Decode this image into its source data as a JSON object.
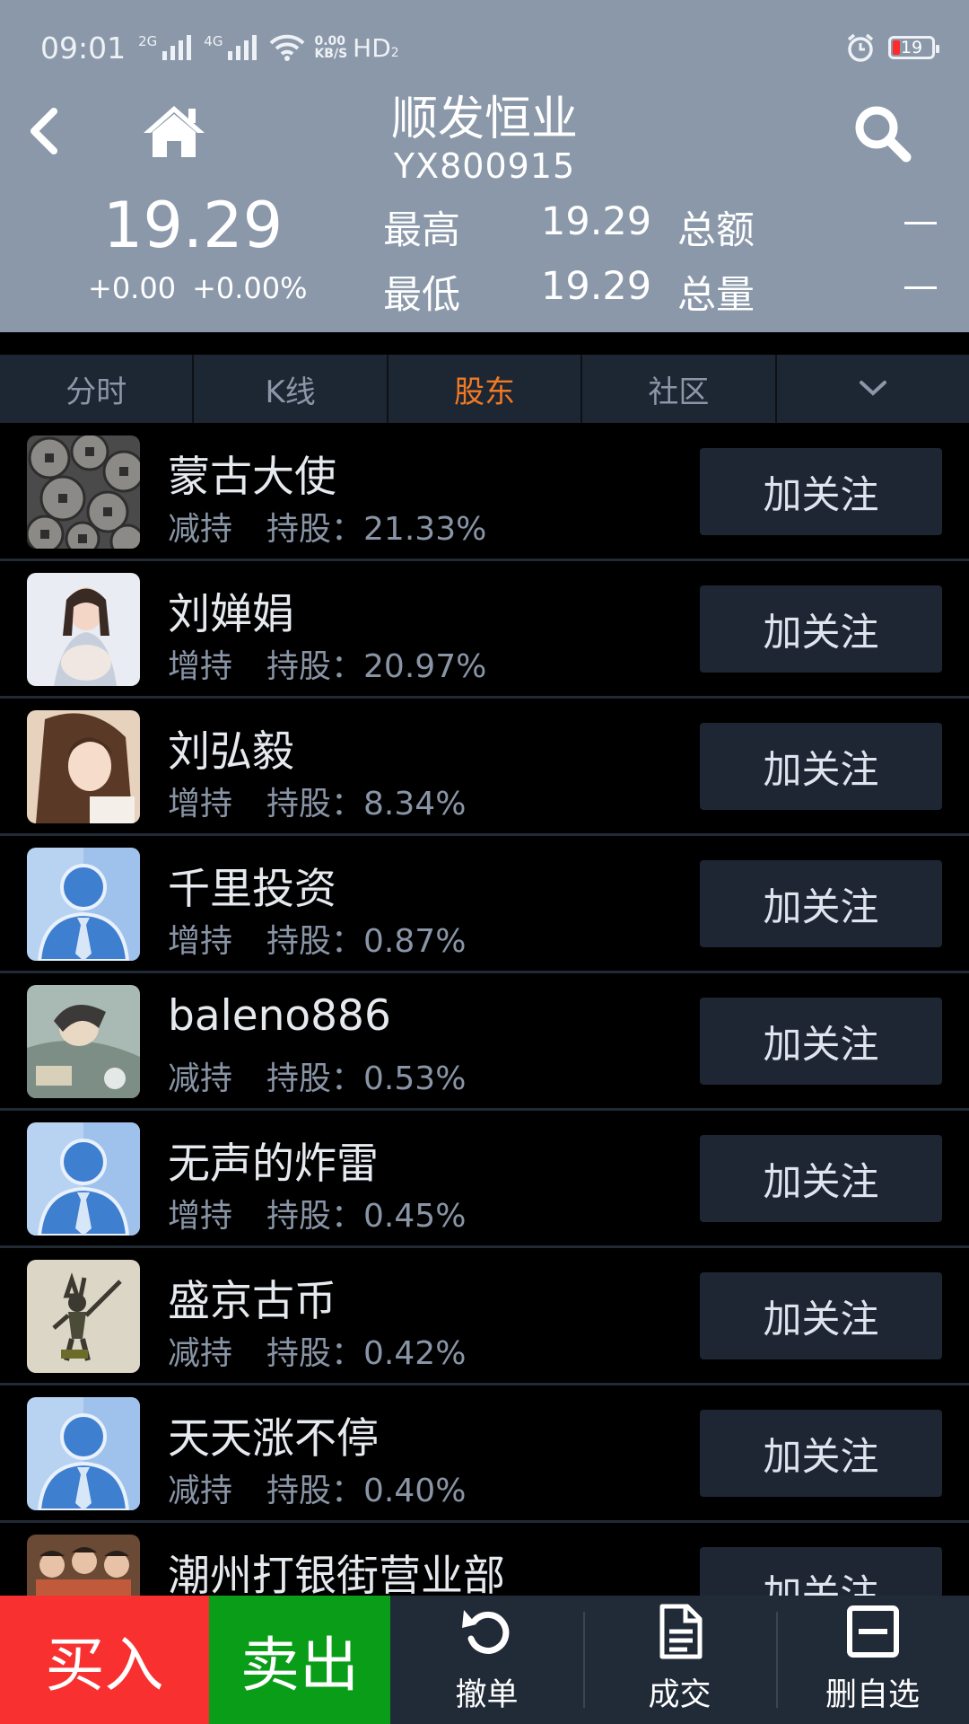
{
  "status_bar": {
    "time": "09:01",
    "sig1": "2G",
    "sig2": "4G",
    "net_speed_value": "0.00",
    "net_speed_unit": "KB/S",
    "hd": "HD",
    "hd_sub": "2",
    "battery": "19"
  },
  "header": {
    "stock_name": "顺发恒业",
    "stock_code": "YX800915",
    "price": "19.29",
    "change_abs": "+0.00",
    "change_pct": "+0.00%",
    "high_label": "最高",
    "high_value": "19.29",
    "low_label": "最低",
    "low_value": "19.29",
    "amount_label": "总额",
    "volume_label": "总量"
  },
  "tabs": [
    {
      "label": "分时"
    },
    {
      "label": "K线"
    },
    {
      "label": "股东",
      "active": true
    },
    {
      "label": "社区"
    }
  ],
  "holders": [
    {
      "name": "蒙古大使",
      "action": "减持",
      "hold_label": "持股：",
      "hold": "21.33%",
      "button": "加关注",
      "avatar": "coins"
    },
    {
      "name": "刘婵娟",
      "action": "增持",
      "hold_label": "持股：",
      "hold": "20.97%",
      "button": "加关注",
      "avatar": "photo-woman-white"
    },
    {
      "name": "刘弘毅",
      "action": "增持",
      "hold_label": "持股：",
      "hold": "8.34%",
      "button": "加关注",
      "avatar": "photo-woman-hair"
    },
    {
      "name": "千里投资",
      "action": "增持",
      "hold_label": "持股：",
      "hold": "0.87%",
      "button": "加关注",
      "avatar": "default-person"
    },
    {
      "name": "baleno886",
      "action": "减持",
      "hold_label": "持股：",
      "hold": "0.53%",
      "button": "加关注",
      "avatar": "anime"
    },
    {
      "name": "无声的炸雷",
      "action": "增持",
      "hold_label": "持股：",
      "hold": "0.45%",
      "button": "加关注",
      "avatar": "default-person"
    },
    {
      "name": "盛京古币",
      "action": "减持",
      "hold_label": "持股：",
      "hold": "0.42%",
      "button": "加关注",
      "avatar": "figure"
    },
    {
      "name": "天天涨不停",
      "action": "减持",
      "hold_label": "持股：",
      "hold": "0.40%",
      "button": "加关注",
      "avatar": "default-person"
    },
    {
      "name": "潮州打银街营业部",
      "action": "",
      "hold_label": "",
      "hold": "",
      "button": "加关注",
      "avatar": "group-photo"
    }
  ],
  "bottom": {
    "buy": "买入",
    "sell": "卖出",
    "cancel": "撤单",
    "deals": "成交",
    "remove_watch": "删自选"
  }
}
